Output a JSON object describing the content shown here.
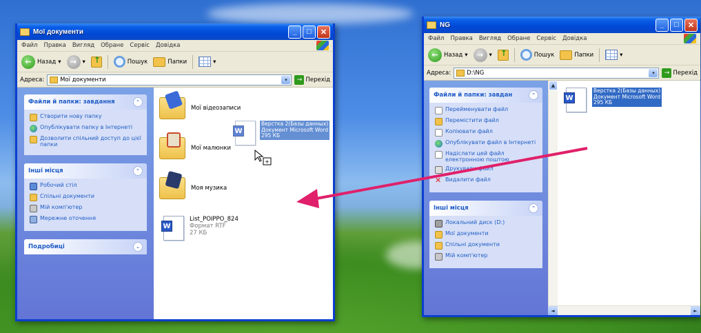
{
  "left_window": {
    "title": "Мої документи",
    "menu": [
      "Файл",
      "Правка",
      "Вигляд",
      "Обране",
      "Сервіс",
      "Довідка"
    ],
    "toolbar": {
      "back": "Назад",
      "search": "Пошук",
      "folders": "Папки"
    },
    "address_label": "Адреса:",
    "address_value": "Мої документи",
    "go_label": "Перехід",
    "tasks_panel": {
      "title": "Файли й папки: завдання",
      "items": [
        "Створити нову папку",
        "Опублікувати папку в Інтернеті",
        "Дозволити спільний доступ до цієї папки"
      ]
    },
    "places_panel": {
      "title": "Інші місця",
      "items": [
        "Робочий стіл",
        "Спільні документи",
        "Мій комп'ютер",
        "Мережне оточення"
      ]
    },
    "details_panel": {
      "title": "Подробиці"
    },
    "files": [
      {
        "name": "Мої відеозаписи"
      },
      {
        "name": "Мої малюнки"
      },
      {
        "name": "Моя музика"
      },
      {
        "name": "List_POIPPO_824",
        "type": "Формат RTF",
        "size": "27 КБ"
      }
    ],
    "drag_ghost": [
      "Верстка 2(Базы данных)",
      "Документ Microsoft Word",
      "295 КБ"
    ]
  },
  "right_window": {
    "title": "NG",
    "menu": [
      "Файл",
      "Правка",
      "Вигляд",
      "Обране",
      "Сервіс",
      "Довідка"
    ],
    "toolbar": {
      "back": "Назад",
      "search": "Пошук",
      "folders": "Папки"
    },
    "address_label": "Адреса:",
    "address_value": "D:\\NG",
    "go_label": "Перехід",
    "tasks_panel": {
      "title": "Файли й папки: завдан",
      "items": [
        "Перейменувати файл",
        "Перемістити файл",
        "Копіювати файл",
        "Опублікувати файл в Інтернеті",
        "Надіслати цей файл електронною поштою",
        "Друкувати файл",
        "Видалити файл"
      ]
    },
    "places_panel": {
      "title": "Інші місця",
      "items": [
        "Локальний диск (D:)",
        "Мої документи",
        "Спільні документи",
        "Мій комп'ютер"
      ]
    },
    "files": [
      {
        "name": "Верстка 2(Базы данных)",
        "type": "Документ Microsoft Word",
        "size": "295 КБ",
        "selected": true
      }
    ]
  },
  "colors": {
    "selection": "#316ac5",
    "arrow": "#e0206a",
    "titlebar": "#0a47c8"
  }
}
